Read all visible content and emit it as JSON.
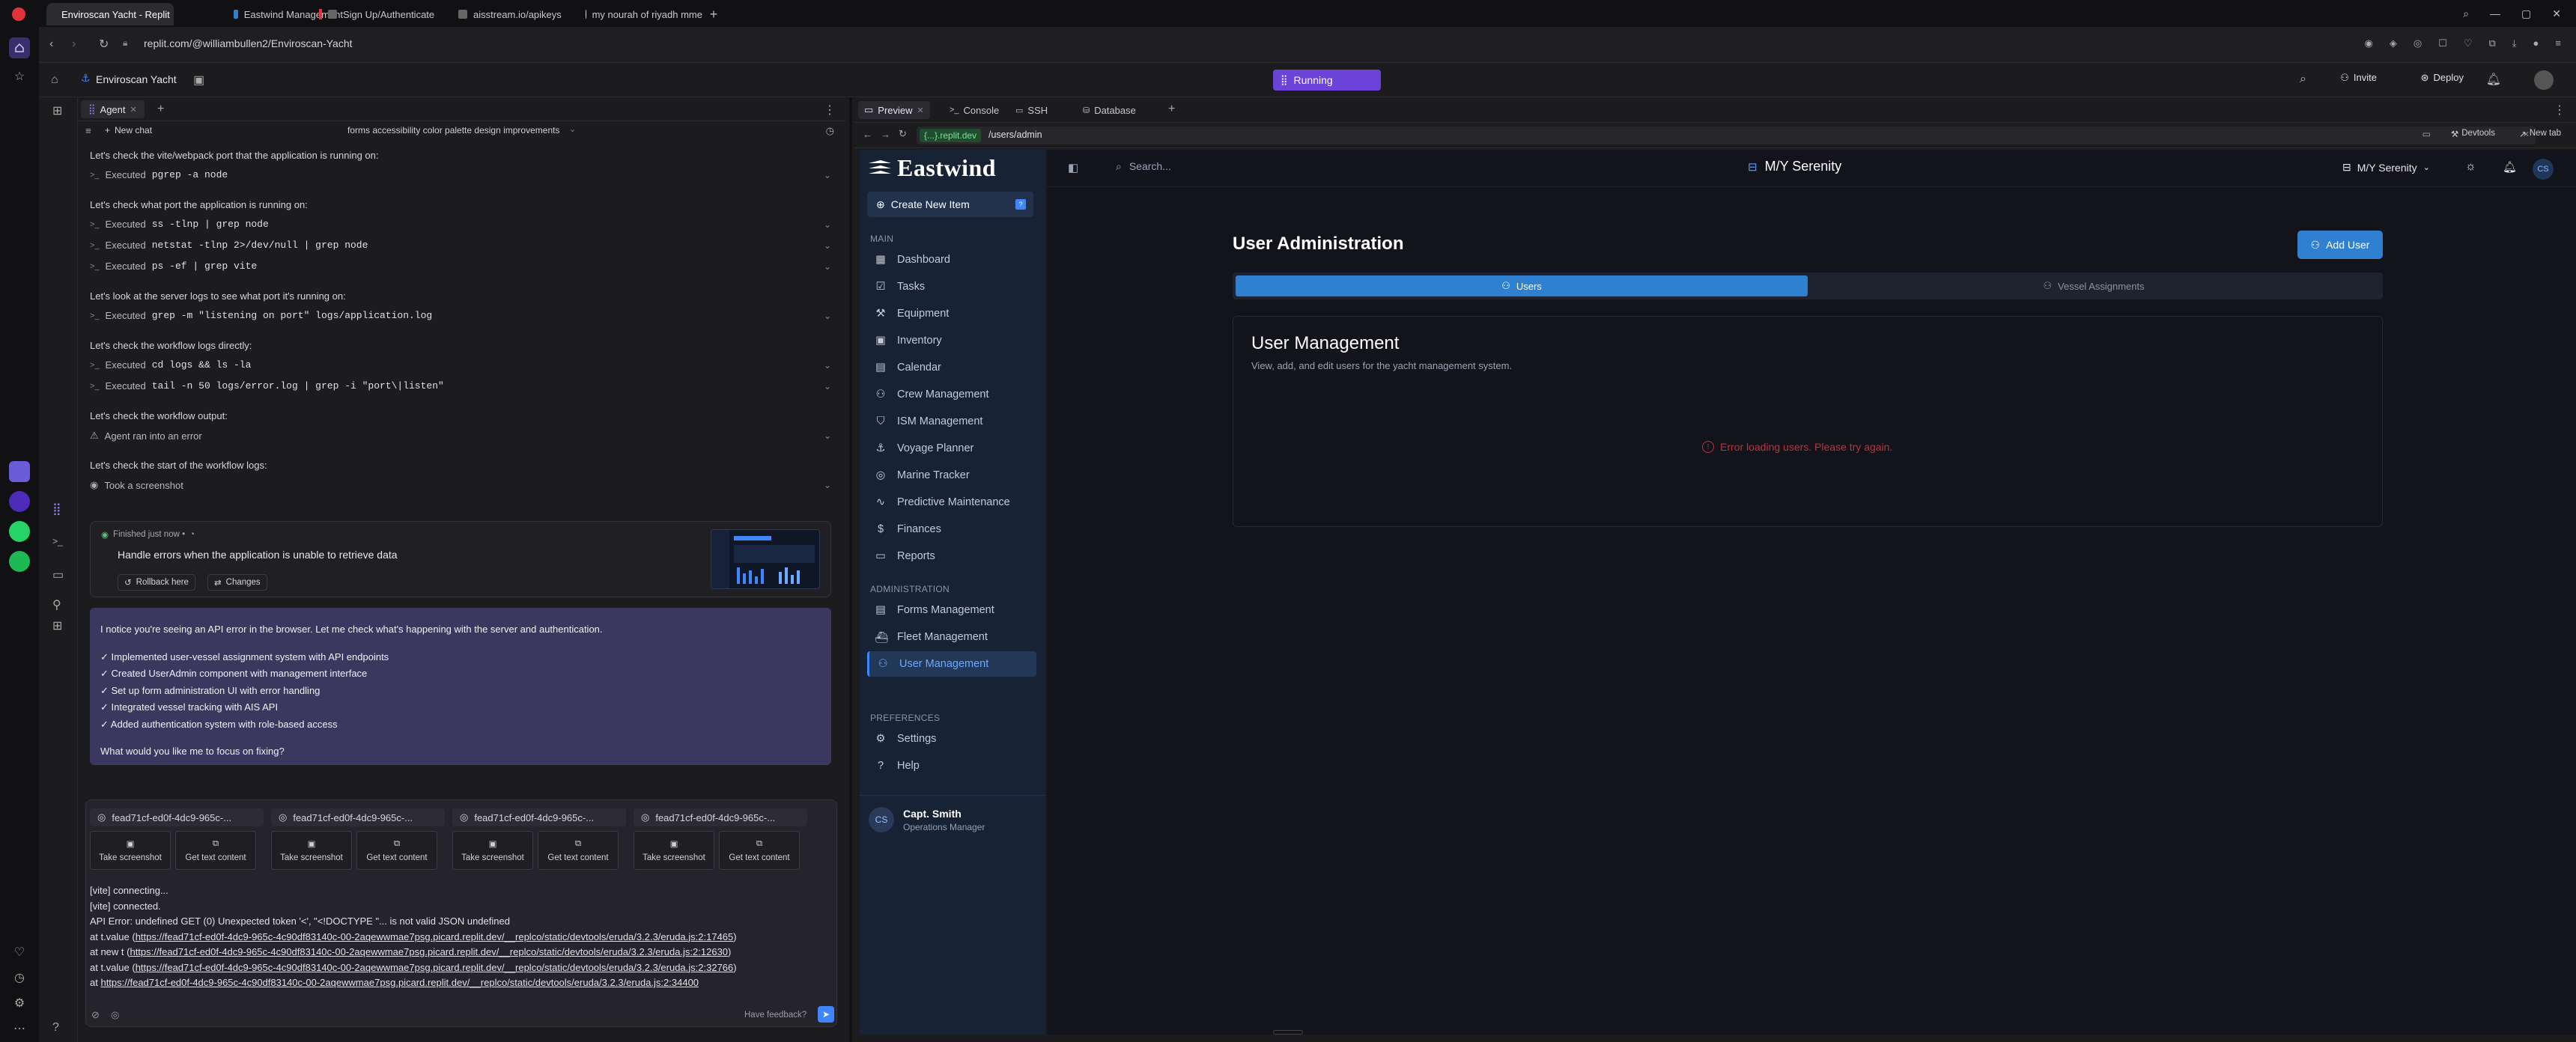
{
  "browser": {
    "tabs": [
      {
        "label": "Enviroscan Yacht - Replit",
        "active": true
      },
      {
        "label": "Eastwind Management",
        "active": false
      },
      {
        "label": "Sign Up/Authenticate",
        "active": false
      },
      {
        "label": "aisstream.io/apikeys",
        "active": false
      },
      {
        "label": "my nourah of riyadh mme",
        "active": false
      }
    ],
    "url": "replit.com/@williambullen2/Enviroscan-Yacht"
  },
  "replit": {
    "project_name": "Enviroscan Yacht",
    "running_label": "Running",
    "invite_label": "Invite",
    "deploy_label": "Deploy"
  },
  "agent": {
    "tab_label": "Agent",
    "new_chat_label": "New chat",
    "chat_title": "forms accessibility color palette design improvements",
    "log": [
      {
        "type": "q",
        "text": "Let's check the vite/webpack port that the application is running on:"
      },
      {
        "type": "e",
        "prefix": "Executed",
        "cmd": "pgrep -a node"
      },
      {
        "type": "q",
        "text": "Let's check what port the application is running on:"
      },
      {
        "type": "e",
        "prefix": "Executed",
        "cmd": "ss -tlnp | grep node"
      },
      {
        "type": "e",
        "prefix": "Executed",
        "cmd": "netstat -tlnp 2>/dev/null | grep node"
      },
      {
        "type": "e",
        "prefix": "Executed",
        "cmd": "ps -ef | grep vite"
      },
      {
        "type": "q",
        "text": "Let's look at the server logs to see what port it's running on:"
      },
      {
        "type": "e",
        "prefix": "Executed",
        "cmd": "grep -m \"listening on port\" logs/application.log"
      },
      {
        "type": "q",
        "text": "Let's check the workflow logs directly:"
      },
      {
        "type": "e",
        "prefix": "Executed",
        "cmd": "cd logs && ls -la"
      },
      {
        "type": "e",
        "prefix": "Executed",
        "cmd": "tail -n 50 logs/error.log | grep -i \"port\\|listen\""
      },
      {
        "type": "q",
        "text": "Let's check the workflow output:"
      },
      {
        "type": "w",
        "text": "Agent ran into an error"
      },
      {
        "type": "q",
        "text": "Let's check the start of the workflow logs:"
      },
      {
        "type": "s",
        "text": "Took a screenshot"
      }
    ],
    "finished": {
      "status": "Finished just now •",
      "title": "Handle errors when the application is unable to retrieve data",
      "rollback_label": "Rollback here",
      "changes_label": "Changes"
    },
    "message": {
      "intro": "I notice you're seeing an API error in the browser. Let me check what's happening with the server and authentication.",
      "items": [
        "✓ Implemented user-vessel assignment system with API endpoints",
        "✓ Created UserAdmin component with management interface",
        "✓ Set up form administration UI with error handling",
        "✓ Integrated vessel tracking with AIS API",
        "✓ Added authentication system with role-based access"
      ],
      "question": "What would you like me to focus on fixing?"
    },
    "sessions": [
      {
        "id": "fead71cf-ed0f-4dc9-965c-...",
        "screenshot": "Take screenshot",
        "content": "Get text content"
      },
      {
        "id": "fead71cf-ed0f-4dc9-965c-...",
        "screenshot": "Take screenshot",
        "content": "Get text content"
      },
      {
        "id": "fead71cf-ed0f-4dc9-965c-...",
        "screenshot": "Take screenshot",
        "content": "Get text content"
      },
      {
        "id": "fead71cf-ed0f-4dc9-965c-...",
        "screenshot": "Take screenshot",
        "content": "Get text content"
      }
    ],
    "console": {
      "lines": [
        "[vite] connecting...",
        "[vite] connected.",
        "API Error: undefined GET (0) Unexpected token '<', \"<!DOCTYPE \"... is not valid JSON undefined"
      ],
      "stack": [
        {
          "prefix": "at t.value (",
          "link": "https://fead71cf-ed0f-4dc9-965c-4c90df83140c-00-2aqewwmae7psg.picard.replit.dev/__replco/static/devtools/eruda/3.2.3/eruda.js:2:17465",
          "suffix": ")"
        },
        {
          "prefix": "at new t (",
          "link": "https://fead71cf-ed0f-4dc9-965c-4c90df83140c-00-2aqewwmae7psg.picard.replit.dev/__replco/static/devtools/eruda/3.2.3/eruda.js:2:12630",
          "suffix": ")"
        },
        {
          "prefix": "at t.value (",
          "link": "https://fead71cf-ed0f-4dc9-965c-4c90df83140c-00-2aqewwmae7psg.picard.replit.dev/__replco/static/devtools/eruda/3.2.3/eruda.js:2:32766",
          "suffix": ")"
        },
        {
          "prefix": "at ",
          "link": "https://fead71cf-ed0f-4dc9-965c-4c90df83140c-00-2aqewwmae7psg.picard.replit.dev/__replco/static/devtools/eruda/3.2.3/eruda.js:2:34400",
          "suffix": ""
        }
      ]
    },
    "feedback_label": "Have feedback?"
  },
  "preview": {
    "tabs": [
      {
        "label": "Preview",
        "active": true
      },
      {
        "label": "Console",
        "active": false
      },
      {
        "label": "SSH",
        "active": false
      },
      {
        "label": "Database",
        "active": false
      }
    ],
    "domain": "{...}.replit.dev",
    "path": "/users/admin",
    "devtools_label": "Devtools",
    "new_tab_label": "New tab"
  },
  "app": {
    "brand": "Eastwind",
    "create_label": "Create New Item",
    "sections": {
      "main": "MAIN",
      "admin": "ADMINISTRATION",
      "prefs": "PREFERENCES"
    },
    "main_nav": [
      {
        "label": "Dashboard",
        "icon": "grid-icon"
      },
      {
        "label": "Tasks",
        "icon": "checklist-icon"
      },
      {
        "label": "Equipment",
        "icon": "wrench-icon"
      },
      {
        "label": "Inventory",
        "icon": "box-icon"
      },
      {
        "label": "Calendar",
        "icon": "calendar-icon"
      },
      {
        "label": "Crew Management",
        "icon": "users-icon"
      },
      {
        "label": "ISM Management",
        "icon": "shield-icon"
      },
      {
        "label": "Voyage Planner",
        "icon": "anchor-icon"
      },
      {
        "label": "Marine Tracker",
        "icon": "globe-icon"
      },
      {
        "label": "Predictive Maintenance",
        "icon": "activity-icon"
      },
      {
        "label": "Finances",
        "icon": "dollar-icon"
      },
      {
        "label": "Reports",
        "icon": "document-icon"
      }
    ],
    "admin_nav": [
      {
        "label": "Forms Management",
        "icon": "form-icon"
      },
      {
        "label": "Fleet Management",
        "icon": "ship-icon"
      },
      {
        "label": "User Management",
        "icon": "users-icon"
      }
    ],
    "pref_nav": [
      {
        "label": "Settings",
        "icon": "gear-icon"
      },
      {
        "label": "Help",
        "icon": "help-icon"
      }
    ],
    "user": {
      "initials": "CS",
      "name": "Capt. Smith",
      "role": "Operations Manager"
    },
    "search_placeholder": "Search...",
    "vessel_title": "M/Y Serenity",
    "vessel_select": "M/Y Serenity",
    "avatar_initials": "CS",
    "page_title": "User Administration",
    "add_user_label": "Add User",
    "tab_users": "Users",
    "tab_vessels": "Vessel Assignments",
    "card_title": "User Management",
    "card_desc": "View, add, and edit users for the yacht management system.",
    "error_text": "Error loading users. Please try again."
  },
  "colors": {
    "accent": "#2f80d0",
    "running": "#6b43d9",
    "message_bg": "#3b3860",
    "error": "#b8353a",
    "app_sidebar": "#172235",
    "app_main": "#13131c"
  }
}
